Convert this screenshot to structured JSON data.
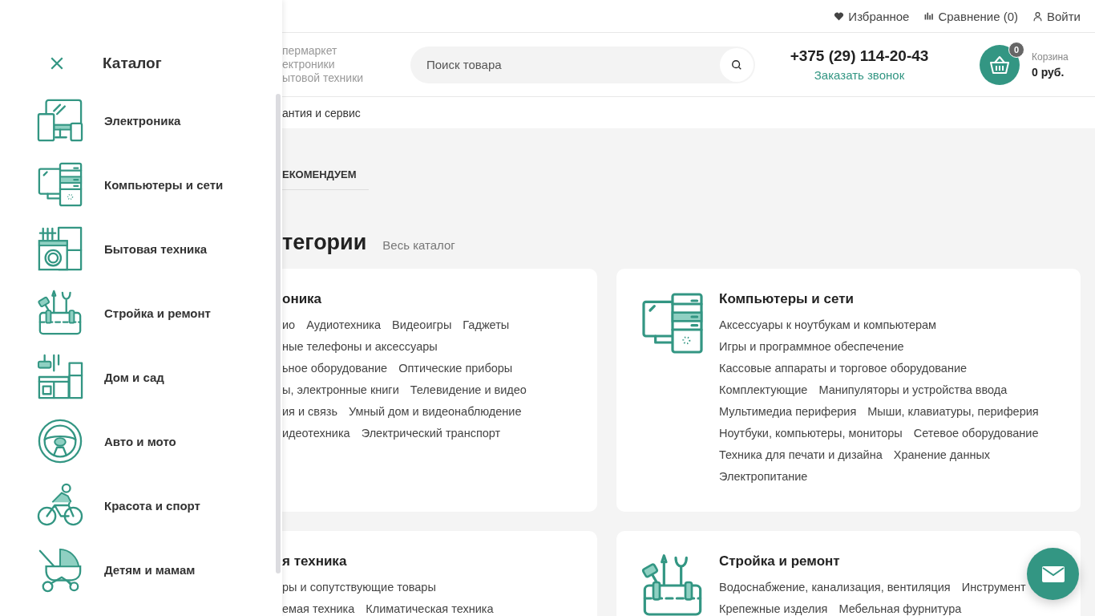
{
  "drawer": {
    "title": "Каталог",
    "items": [
      {
        "label": "Электроника",
        "kind": "electronics"
      },
      {
        "label": "Компьютеры и сети",
        "kind": "computers"
      },
      {
        "label": "Бытовая техника",
        "kind": "appliances"
      },
      {
        "label": "Стройка и ремонт",
        "kind": "tools"
      },
      {
        "label": "Дом и сад",
        "kind": "home"
      },
      {
        "label": "Авто и мото",
        "kind": "auto"
      },
      {
        "label": "Красота и спорт",
        "kind": "sport"
      },
      {
        "label": "Детям и мамам",
        "kind": "kids"
      }
    ]
  },
  "top_links": [
    {
      "kind": "favorites",
      "label": "Избранное"
    },
    {
      "kind": "compare",
      "label": "Сравнение (0)"
    },
    {
      "kind": "login",
      "label": "Войти"
    }
  ],
  "header": {
    "logo_lines": [
      "пермаркет",
      "ектроники",
      "ытовой техники"
    ],
    "search": {
      "placeholder": "Поиск товара"
    },
    "phone": "+375 (29) 114-20-43",
    "callback": "Заказать звонок",
    "cart": {
      "count": "0",
      "label": "Корзина",
      "sum": "0 руб."
    }
  },
  "nav": [
    "антия и сервис"
  ],
  "tabs": [
    {
      "label": "ЕКОМЕНДУЕМ",
      "selected": true
    }
  ],
  "categories": {
    "heading": "тегории",
    "all_link": "Весь каталог",
    "cards": [
      {
        "title": "оника",
        "lines": [
          {
            "links": [
              "ио",
              "Аудиотехника",
              "Видеоигры",
              "Гаджеты"
            ]
          },
          {
            "links": [
              "ные телефоны и аксессуары"
            ]
          },
          {
            "links": [
              "ьное оборудование",
              "Оптические приборы"
            ]
          },
          {
            "links": [
              "ы, электронные книги",
              "Телевидение и видео"
            ]
          },
          {
            "links": [
              "ия и связь",
              "Умный дом и видеонаблюдение"
            ]
          },
          {
            "links": [
              "идеотехника",
              "Электрический транспорт"
            ]
          }
        ]
      },
      {
        "title": "Компьютеры и сети",
        "kind": "computers",
        "lines": [
          {
            "links": [
              "Аксессуары к ноутбукам и компьютерам"
            ]
          },
          {
            "links": [
              "Игры и программное обеспечение"
            ]
          },
          {
            "links": [
              "Кассовые аппараты и торговое оборудование"
            ]
          },
          {
            "links": [
              "Комплектующие",
              "Манипуляторы и устройства ввода"
            ]
          },
          {
            "links": [
              "Мультимедиа периферия",
              "Мыши, клавиатуры, периферия"
            ]
          },
          {
            "links": [
              "Ноутбуки, компьютеры, мониторы",
              "Сетевое оборудование"
            ]
          },
          {
            "links": [
              "Техника для печати и дизайна",
              "Хранение данных"
            ]
          },
          {
            "links": [
              "Электропитание"
            ]
          }
        ]
      },
      {
        "title": "я техника",
        "lines": [
          {
            "links": [
              "ры и сопутствующие товары"
            ]
          },
          {
            "links": [
              "емая техника",
              "Климатическая техника"
            ]
          }
        ]
      },
      {
        "title": "Стройка и ремонт",
        "kind": "tools",
        "lines": [
          {
            "links": [
              "Водоснабжение, канализация, вентиляция",
              "Инструмент"
            ]
          },
          {
            "links": [
              "Крепежные изделия",
              "Мебельная фурнитура"
            ]
          }
        ]
      }
    ]
  }
}
